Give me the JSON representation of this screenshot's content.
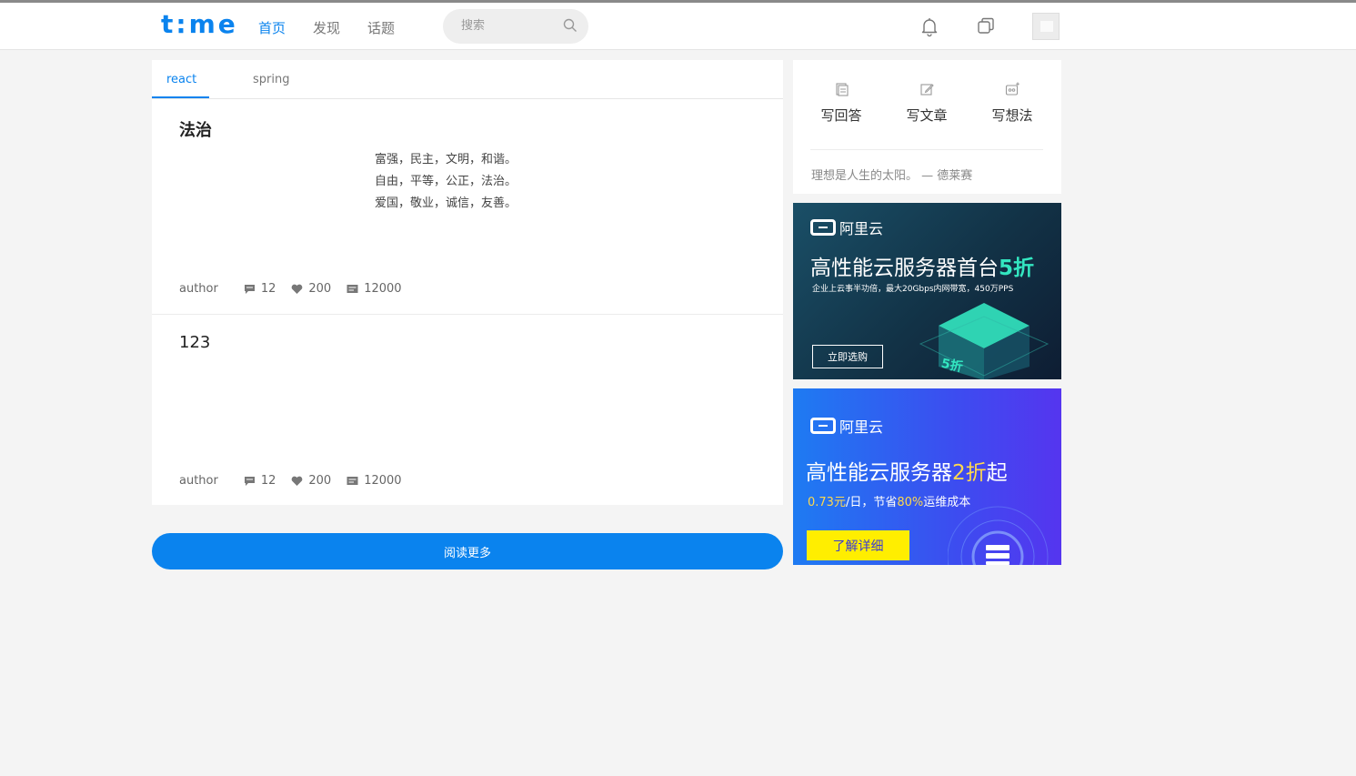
{
  "header": {
    "logo": "t:me",
    "nav": [
      {
        "label": "首页",
        "active": true
      },
      {
        "label": "发现",
        "active": false
      },
      {
        "label": "话题",
        "active": false
      }
    ],
    "search_placeholder": "搜索"
  },
  "tabs": [
    {
      "label": "react",
      "active": true
    },
    {
      "label": "spring",
      "active": false
    }
  ],
  "articles": [
    {
      "title": "法治",
      "lines": [
        "富强，民主，文明，和谐。",
        "自由，平等，公正，法治。",
        "爱国，敬业，诚信，友善。"
      ],
      "author": "author",
      "comments": "12",
      "likes": "200",
      "views": "12000"
    },
    {
      "title": "123",
      "lines": [],
      "author": "author",
      "comments": "12",
      "likes": "200",
      "views": "12000"
    }
  ],
  "read_more": "阅读更多",
  "write_panel": {
    "actions": [
      {
        "label": "写回答",
        "icon": "answer-icon"
      },
      {
        "label": "写文章",
        "icon": "edit-icon"
      },
      {
        "label": "写想法",
        "icon": "idea-icon"
      }
    ],
    "quote": "理想是人生的太阳。 — 德莱赛"
  },
  "ads": [
    {
      "brand": "阿里云",
      "headline_main": "高性能云服务器首台",
      "headline_accent": "5折",
      "subline": "企业上云事半功倍，最大20Gbps内网带宽，450万PPS",
      "cta": "立即选购",
      "badge": "5折"
    },
    {
      "brand": "阿里云",
      "headline_main": "高性能云服务器",
      "headline_accent": "2折",
      "headline_tail": "起",
      "subline_price": "0.73元",
      "subline_a": "/日，节省",
      "subline_pct": "80%",
      "subline_b": "运维成本",
      "cta": "了解详细"
    }
  ],
  "colors": {
    "accent": "#0a83ee",
    "ad_highlight": "#33e6c0",
    "ad_yellow": "#ffee00"
  }
}
